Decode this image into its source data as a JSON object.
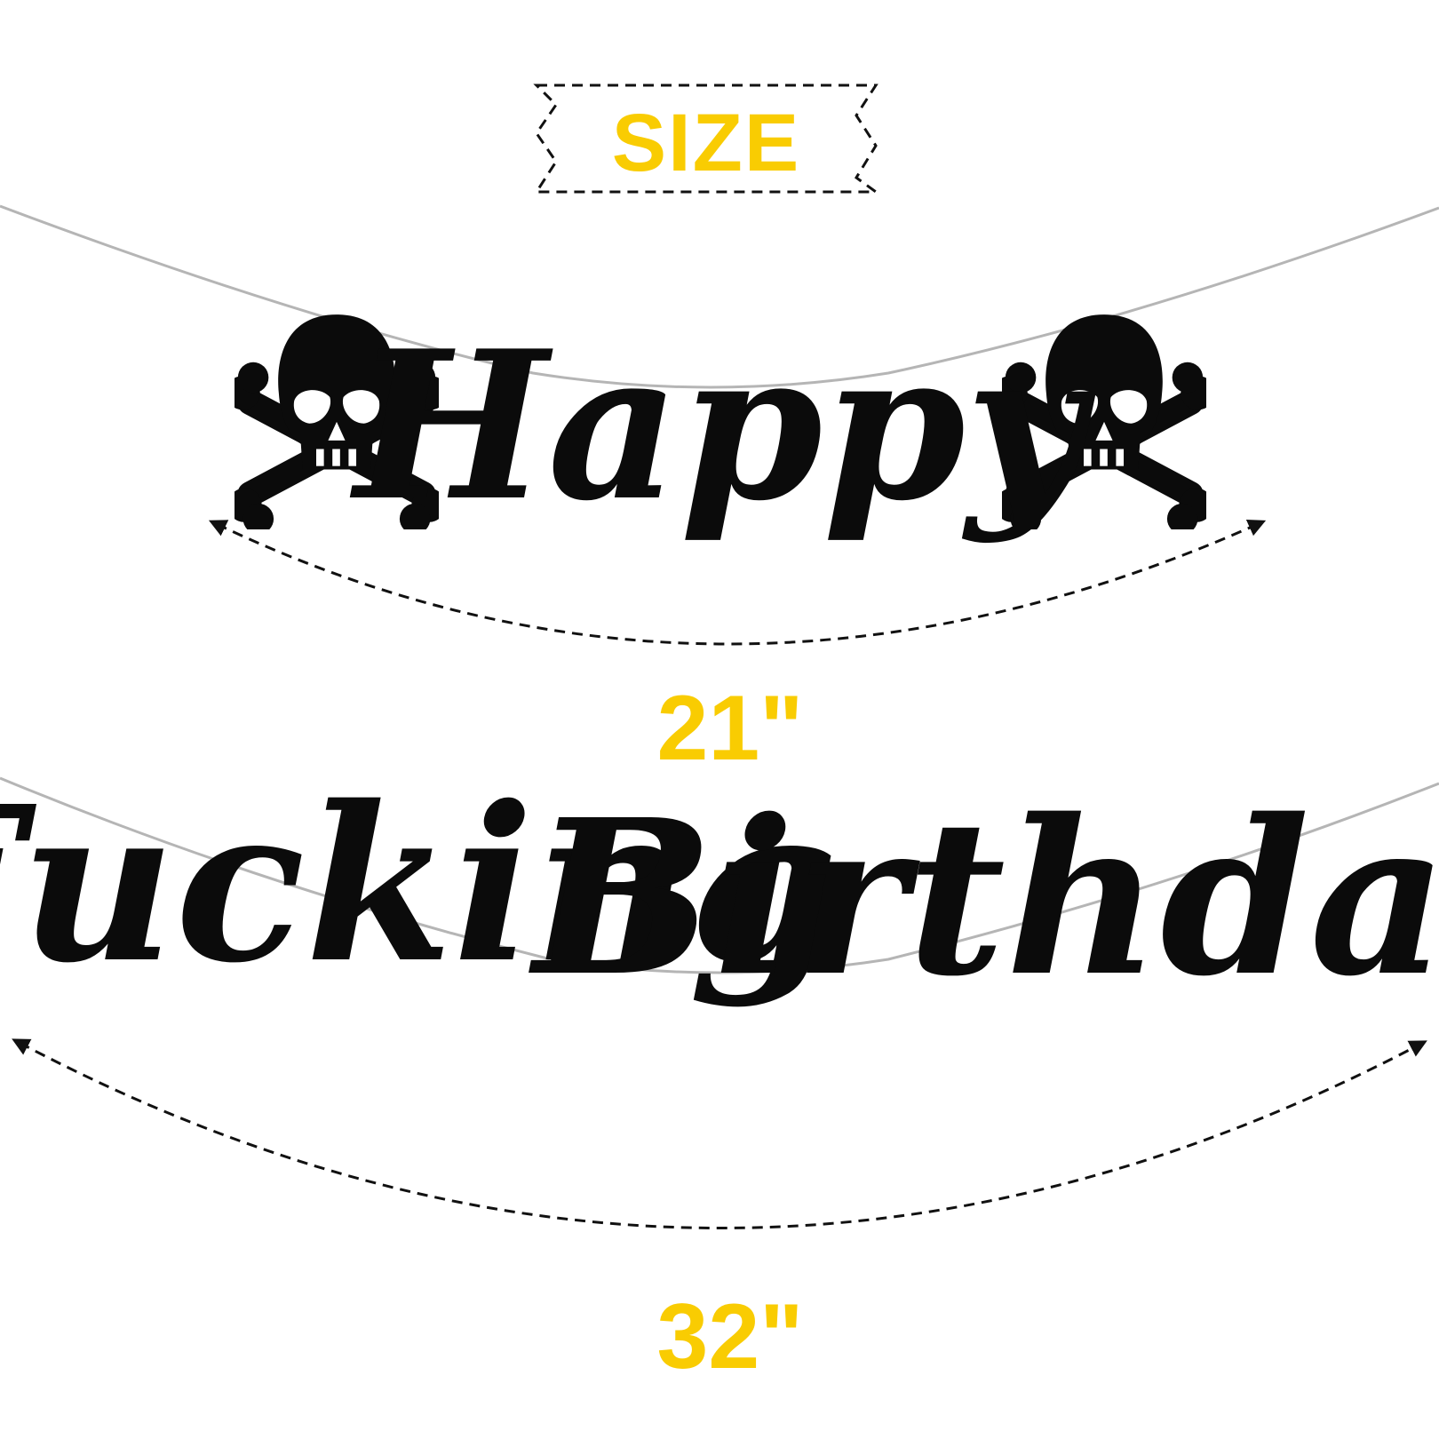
{
  "size_badge": {
    "label": "SIZE"
  },
  "banner_top": {
    "word": "Happy",
    "length_label": "21\"",
    "decoration_icon": "skull-crossbones-icon"
  },
  "banner_bottom": {
    "words": [
      "Fucking",
      "Birthday"
    ],
    "length_label": "32\""
  },
  "colors": {
    "accent_yellow": "#f9cc02",
    "banner_black": "#0b0b0b",
    "string_gray": "#b5b5b5",
    "arrow_black": "#111111"
  }
}
